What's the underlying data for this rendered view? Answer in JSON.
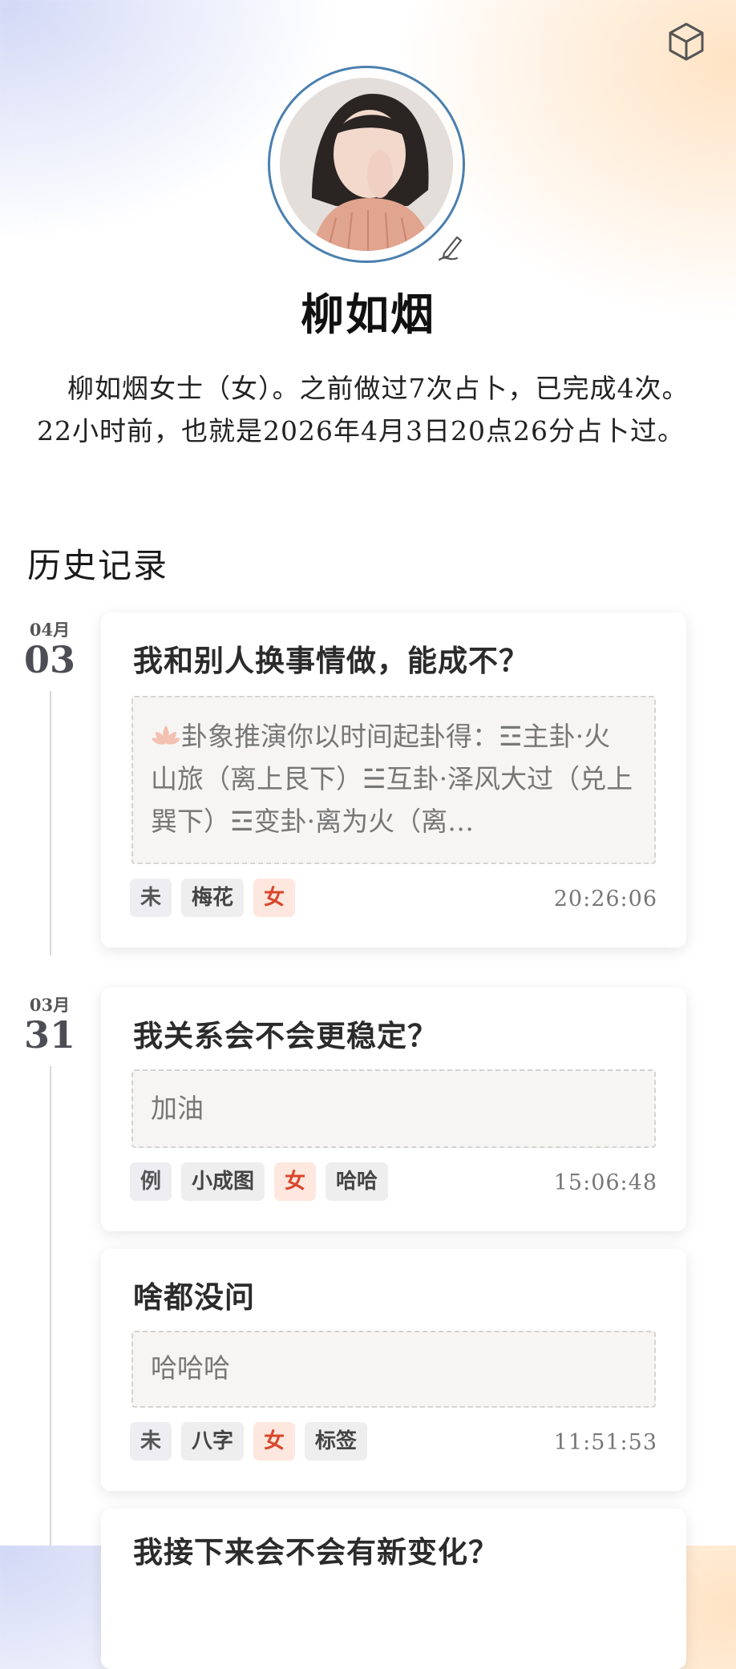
{
  "profile": {
    "name": "柳如烟",
    "bio": "柳如烟女士（女）。之前做过7次占卜，已完成4次。22小时前，也就是2026年4月3日20点26分占卜过。"
  },
  "section_title": "历史记录",
  "icons": {
    "top_right": "cube-icon",
    "avatar_edit": "edit-pen-icon",
    "lotus": "lotus-icon"
  },
  "colors": {
    "tag_red_text": "#d9462b",
    "tag_red_bg": "#fde7de",
    "avatar_ring": "#4a7fae"
  },
  "groups": [
    {
      "month": "04月",
      "day": "03",
      "records": [
        {
          "title": "我和别人换事情做，能成不？",
          "content": "卦象推演你以时间起卦得：☲主卦·火山旅（离上艮下）☱互卦·泽风大过（兑上巽下）☲变卦·离为火（离…",
          "tags": [
            "未",
            "梅花",
            "女"
          ],
          "time": "20:26:06"
        }
      ]
    },
    {
      "month": "03月",
      "day": "31",
      "records": [
        {
          "title": "我关系会不会更稳定？",
          "content": "加油",
          "tags": [
            "例",
            "小成图",
            "女",
            "哈哈"
          ],
          "time": "15:06:48"
        },
        {
          "title": "啥都没问",
          "content": "哈哈哈",
          "tags": [
            "未",
            "八字",
            "女",
            "标签"
          ],
          "time": "11:51:53"
        },
        {
          "title": "我接下来会不会有新变化？"
        }
      ]
    }
  ]
}
